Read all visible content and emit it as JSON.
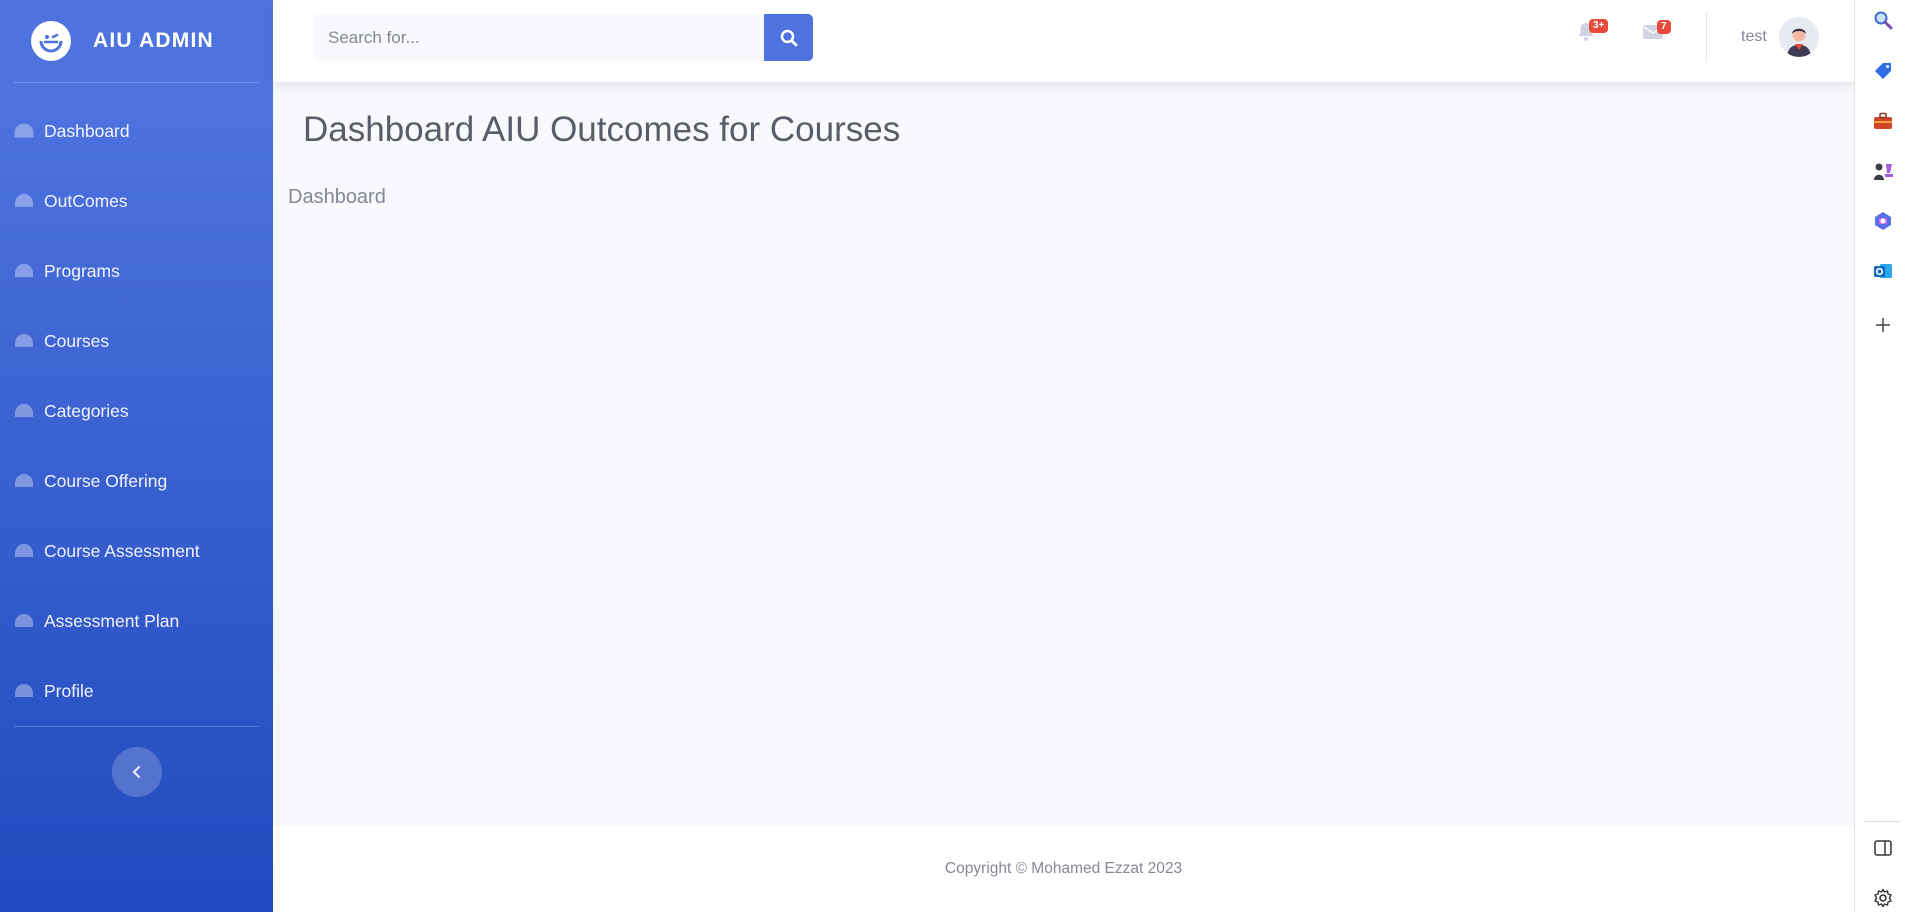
{
  "sidebar": {
    "brand": "AIU ADMIN",
    "items": [
      {
        "label": "Dashboard"
      },
      {
        "label": "OutComes"
      },
      {
        "label": "Programs"
      },
      {
        "label": "Courses"
      },
      {
        "label": "Categories"
      },
      {
        "label": "Course Offering"
      },
      {
        "label": "Course Assessment"
      },
      {
        "label": "Assessment Plan"
      },
      {
        "label": "Profile"
      }
    ],
    "icon": "tachometer-icon"
  },
  "topbar": {
    "search_placeholder": "Search for...",
    "alerts_badge": "3+",
    "messages_badge": "7",
    "user_name": "test"
  },
  "main": {
    "title": "Dashboard AIU Outcomes for Courses",
    "section_label": "Dashboard"
  },
  "footer": {
    "copyright": "Copyright © Mohamed Ezzat 2023"
  },
  "colors": {
    "primary": "#4e73df",
    "sidebar_gradient_end": "#224abe",
    "danger": "#e74a3b",
    "text_gray": "#858796",
    "heading": "#5a5c69"
  },
  "browser_rail": {
    "icons": [
      "search-icon",
      "tag-icon",
      "toolbox-icon",
      "chess-icon",
      "copilot-icon",
      "outlook-icon",
      "plus-icon",
      "sidebar-toggle-icon",
      "settings-icon"
    ]
  }
}
